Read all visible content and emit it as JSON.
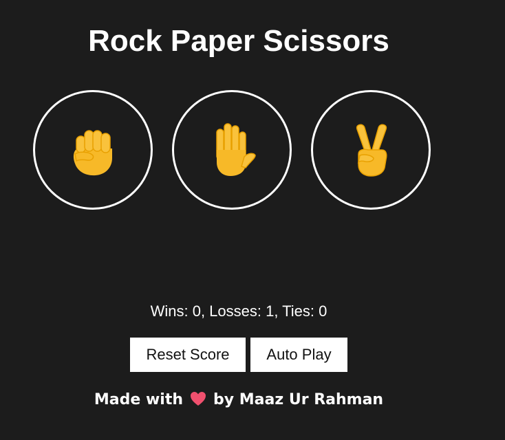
{
  "title": "Rock Paper Scissors",
  "moves": [
    {
      "name": "rock",
      "icon": "raised-fist-emoji"
    },
    {
      "name": "paper",
      "icon": "raised-hand-emoji"
    },
    {
      "name": "scissors",
      "icon": "victory-hand-emoji"
    }
  ],
  "score": {
    "text": "Wins: 0, Losses: 1, Ties: 0",
    "wins": 0,
    "losses": 1,
    "ties": 0
  },
  "controls": {
    "reset_label": "Reset Score",
    "auto_play_label": "Auto Play"
  },
  "footer": {
    "prefix": "Made with",
    "icon": "heart-emoji",
    "suffix": "by Maaz Ur Rahman"
  },
  "colors": {
    "background": "#1c1c1c",
    "text": "#ffffff",
    "emoji": "#f7b928",
    "heart": "#f0506e"
  }
}
